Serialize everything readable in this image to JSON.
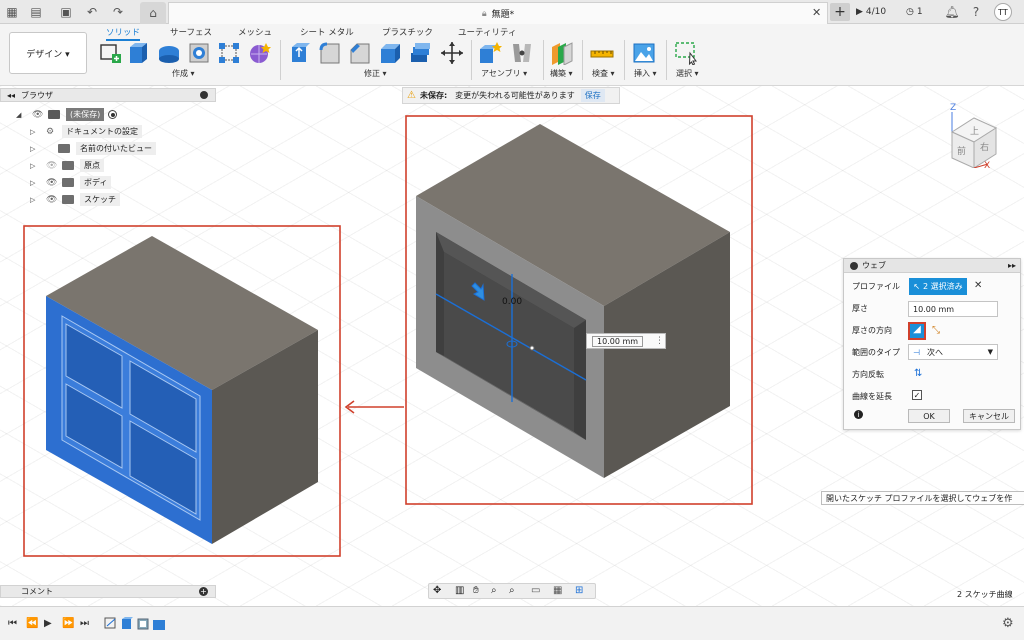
{
  "titlebar": {
    "doc_title": "無題*",
    "jobs_label": "4/10",
    "notifications_count": "1",
    "user_initials": "TT"
  },
  "toolbar": {
    "workspace_label": "デザイン ▾",
    "tabs": [
      "ソリッド",
      "サーフェス",
      "メッシュ",
      "シート メタル",
      "プラスチック",
      "ユーティリティ"
    ],
    "groups": [
      "作成 ▾",
      "修正 ▾",
      "アセンブリ ▾",
      "構築 ▾",
      "検査 ▾",
      "挿入 ▾",
      "選択 ▾"
    ]
  },
  "browser": {
    "title": "ブラウザ",
    "items": [
      {
        "label": "(未保存)"
      },
      {
        "label": "ドキュメントの設定"
      },
      {
        "label": "名前の付いたビュー"
      },
      {
        "label": "原点"
      },
      {
        "label": "ボディ"
      },
      {
        "label": "スケッチ"
      }
    ]
  },
  "warning": {
    "prefix": "未保存:",
    "message": "変更が失われる可能性があります",
    "save_label": "保存"
  },
  "viewcube": {
    "top": "上",
    "front": "前",
    "right": "右",
    "z": "Z",
    "x": "X"
  },
  "dimension": {
    "value": "10.00 mm",
    "partial": "0.00"
  },
  "dialog": {
    "title": "ウェブ",
    "profile_label": "プロファイル",
    "profile_value": "2 選択済み",
    "thickness_label": "厚さ",
    "thickness_value": "10.00 mm",
    "direction_label": "厚さの方向",
    "extent_label": "範囲のタイプ",
    "extent_value": "次へ",
    "flip_label": "方向反転",
    "extend_label": "曲線を延長",
    "ok_label": "OK",
    "cancel_label": "キャンセル"
  },
  "tooltip": {
    "text": "開いたスケッチ プロファイルを選択してウェブを作"
  },
  "comments": {
    "label": "コメント"
  },
  "status": {
    "text": "2 スケッチ曲線"
  },
  "colors": {
    "accent": "#1b7fd4",
    "highlight_box": "#d0402c",
    "body_gray": "#6f6b66",
    "face_blue": "#2d6fd0"
  }
}
